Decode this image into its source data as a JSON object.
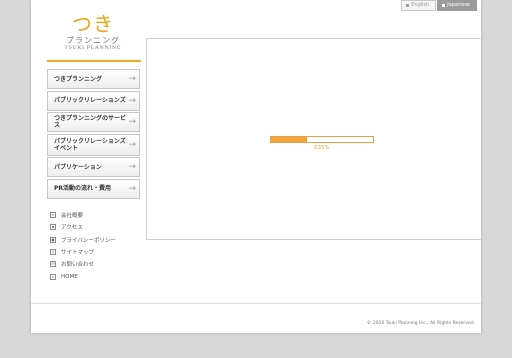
{
  "lang": {
    "english": "English",
    "japanese": "Japanese"
  },
  "logo": {
    "main": "つき",
    "kana": "プランニング",
    "en": "TSUKI PLANNING"
  },
  "nav": {
    "items": [
      {
        "label": "つきプランニング"
      },
      {
        "label": "パブリックリレーションズ"
      },
      {
        "label": "つきプランニングのサービス"
      },
      {
        "label": "パブリックリレーションズ\nイベント"
      },
      {
        "label": "パブリケーション"
      },
      {
        "label": "PR活動の流れ・費用"
      }
    ]
  },
  "sub": {
    "items": [
      {
        "label": "会社概要",
        "icon": "document-icon"
      },
      {
        "label": "アクセス",
        "icon": "map-icon"
      },
      {
        "label": "プライバシーポリシー",
        "icon": "person-icon"
      },
      {
        "label": "サイトマップ",
        "icon": "sitemap-icon"
      },
      {
        "label": "お問い合わせ",
        "icon": "mail-icon"
      },
      {
        "label": "HOME",
        "icon": "home-icon"
      }
    ]
  },
  "loader": {
    "percent_text": "035%",
    "progress": 0.35
  },
  "footer": {
    "copyright": "© 2010 Tsuki Planning Inc., All Rights Reserved."
  },
  "colors": {
    "accent": "#f2a33a",
    "logo": "#e8a31a"
  }
}
